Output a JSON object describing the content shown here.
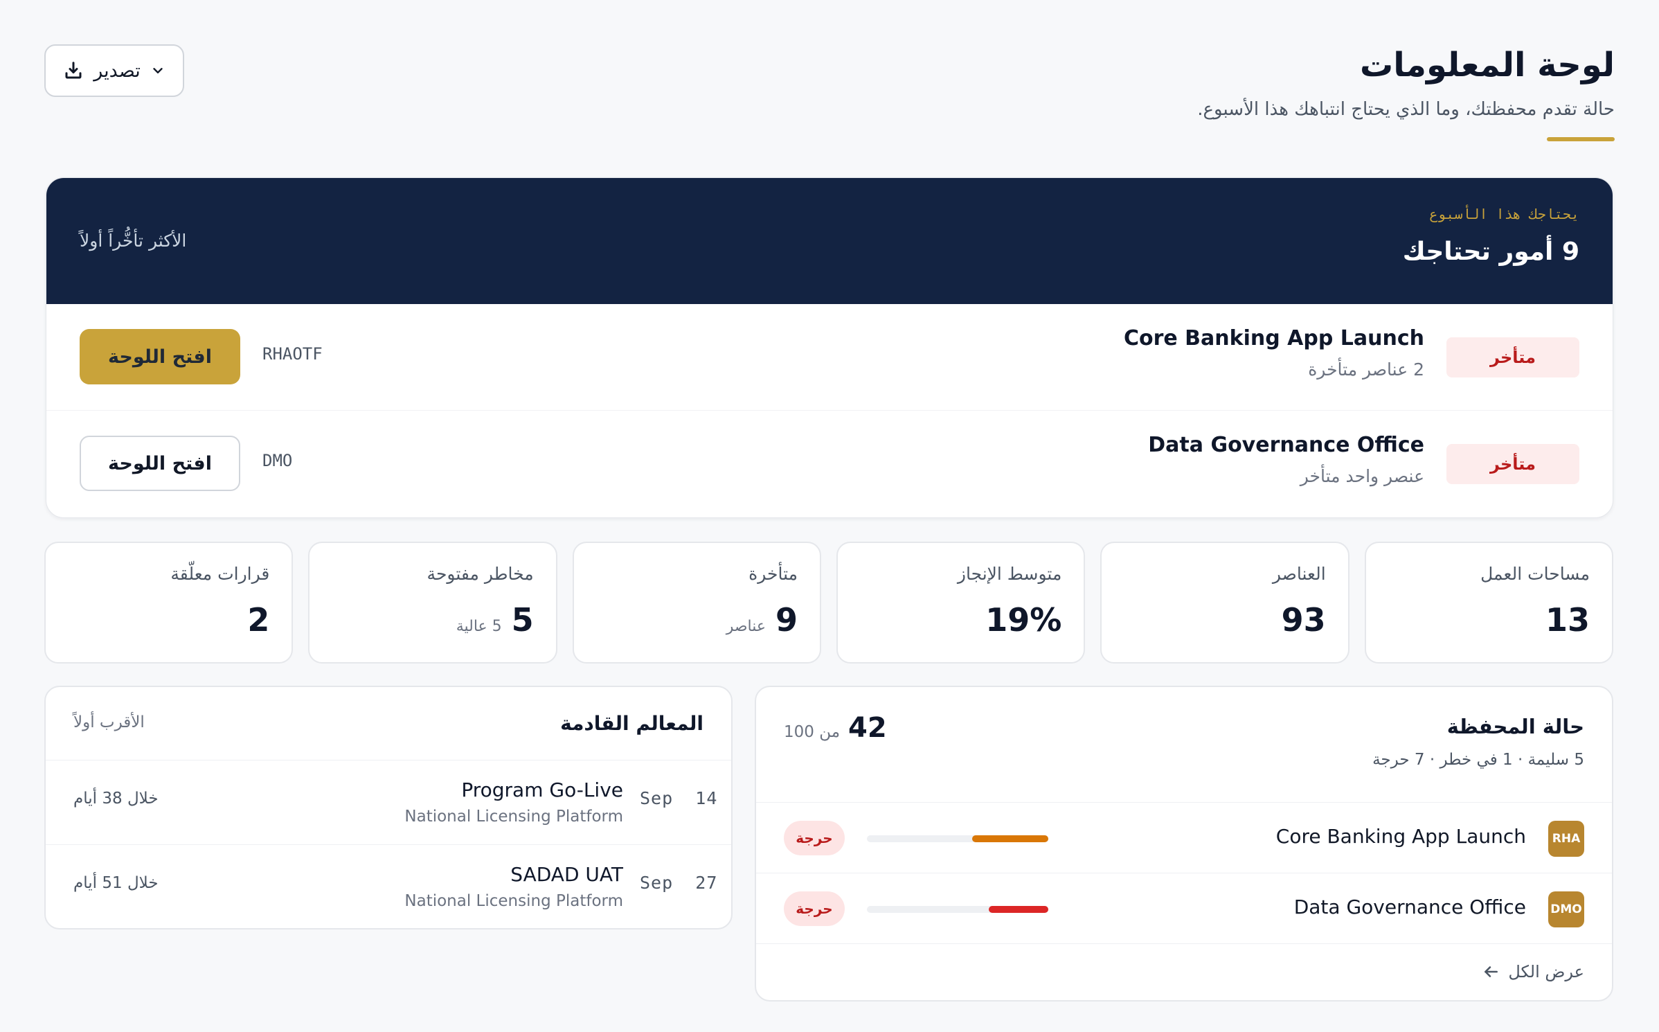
{
  "header": {
    "title": "لوحة المعلومات",
    "subtitle": "حالة تقدم محفظتك، وما الذي يحتاج انتباهك هذا الأسبوع.",
    "export_label": "تصدير"
  },
  "attention": {
    "kicker": "يحتاجك هذا الأسبوع",
    "title": "9 أمور تحتاجك",
    "sort_label": "الأكثر تأخُّراً أولاً",
    "rows": [
      {
        "status": "متأخر",
        "name": "Core Banking App Launch",
        "detail": "2 عناصر متأخرة",
        "code": "RHAOTF",
        "button": "افتح اللوحة"
      },
      {
        "status": "متأخر",
        "name": "Data Governance Office",
        "detail": "عنصر واحد متأخر",
        "code": "DMO",
        "button": "افتح اللوحة"
      }
    ]
  },
  "stats": [
    {
      "label": "مساحات العمل",
      "value": "13",
      "note": ""
    },
    {
      "label": "العناصر",
      "value": "93",
      "note": ""
    },
    {
      "label": "متوسط الإنجاز",
      "value": "19%",
      "note": ""
    },
    {
      "label": "متأخرة",
      "value": "9",
      "note": "عناصر"
    },
    {
      "label": "مخاطر مفتوحة",
      "value": "5",
      "note": "5 عالية"
    },
    {
      "label": "قرارات معلّقة",
      "value": "2",
      "note": ""
    }
  ],
  "portfolio": {
    "title": "حالة المحفظة",
    "summary": "5 سليمة · 1 في خطر · 7 حرجة",
    "score": "42",
    "score_suffix": "من 100",
    "rows": [
      {
        "initials": "RHA",
        "name": "Core Banking App Launch",
        "progress": 0.42,
        "bar_color": "#d97706",
        "status": "حرجة"
      },
      {
        "initials": "DMO",
        "name": "Data Governance Office",
        "progress": 0.33,
        "bar_color": "#dc2626",
        "status": "حرجة"
      }
    ],
    "view_all": "عرض الكل"
  },
  "milestones": {
    "title": "المعالم القادمة",
    "sort_label": "الأقرب أولاً",
    "rows": [
      {
        "day": "14",
        "month": "Sep",
        "name": "Program Go-Live",
        "project": "National Licensing Platform",
        "due": "خلال 38 أيام"
      },
      {
        "day": "27",
        "month": "Sep",
        "name": "SADAD UAT",
        "project": "National Licensing Platform",
        "due": "خلال 51 أيام"
      }
    ]
  }
}
